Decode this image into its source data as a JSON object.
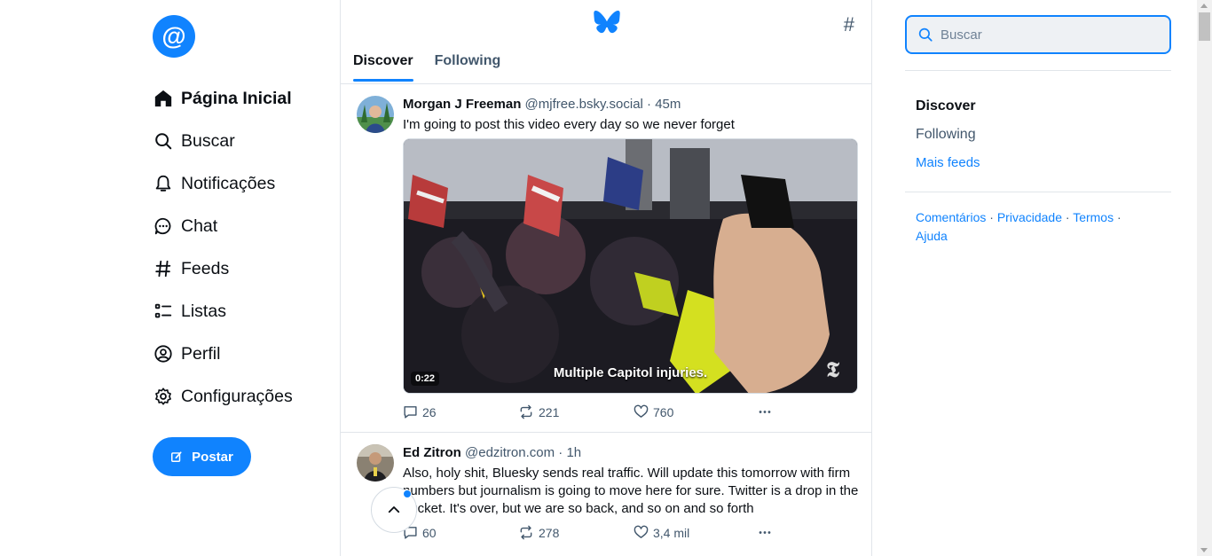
{
  "colors": {
    "accent": "#1083fe",
    "text": "#0b0f14",
    "muted": "#42576c",
    "border": "#e1e5ea"
  },
  "logo": {
    "glyph": "@"
  },
  "nav": {
    "items": [
      {
        "label": "Página Inicial",
        "icon": "home-icon"
      },
      {
        "label": "Buscar",
        "icon": "search-icon"
      },
      {
        "label": "Notificações",
        "icon": "bell-icon"
      },
      {
        "label": "Chat",
        "icon": "chat-icon"
      },
      {
        "label": "Feeds",
        "icon": "hash-icon"
      },
      {
        "label": "Listas",
        "icon": "list-icon"
      },
      {
        "label": "Perfil",
        "icon": "user-circle-icon"
      },
      {
        "label": "Configurações",
        "icon": "gear-icon"
      }
    ],
    "post_label": "Postar"
  },
  "header": {
    "tabs": [
      {
        "label": "Discover"
      },
      {
        "label": "Following"
      }
    ],
    "hash_glyph": "#"
  },
  "posts": [
    {
      "name": "Morgan J Freeman",
      "handle": "@mjfree.bsky.social",
      "time": "· 45m",
      "text": "I'm going to post this video every day so we never forget",
      "video": {
        "duration": "0:22",
        "caption": "Multiple Capitol injuries.",
        "watermark": "𝕿"
      },
      "replies": "26",
      "reposts": "221",
      "likes": "760"
    },
    {
      "name": "Ed Zitron",
      "handle": "@edzitron.com",
      "time": "· 1h",
      "text": "Also, holy shit, Bluesky sends real traffic. Will update this tomorrow with firm numbers but journalism is going to move here for sure. Twitter is a drop in the bucket. It's over, but we are so back, and so on and so forth",
      "replies": "60",
      "reposts": "278",
      "likes": "3,4 mil"
    }
  ],
  "search": {
    "placeholder": "Buscar",
    "value": ""
  },
  "feeds": {
    "current": "Discover",
    "other": "Following",
    "more": "Mais feeds"
  },
  "footer": {
    "links": [
      "Comentários",
      "Privacidade",
      "Termos",
      "Ajuda"
    ],
    "separator": "·"
  }
}
